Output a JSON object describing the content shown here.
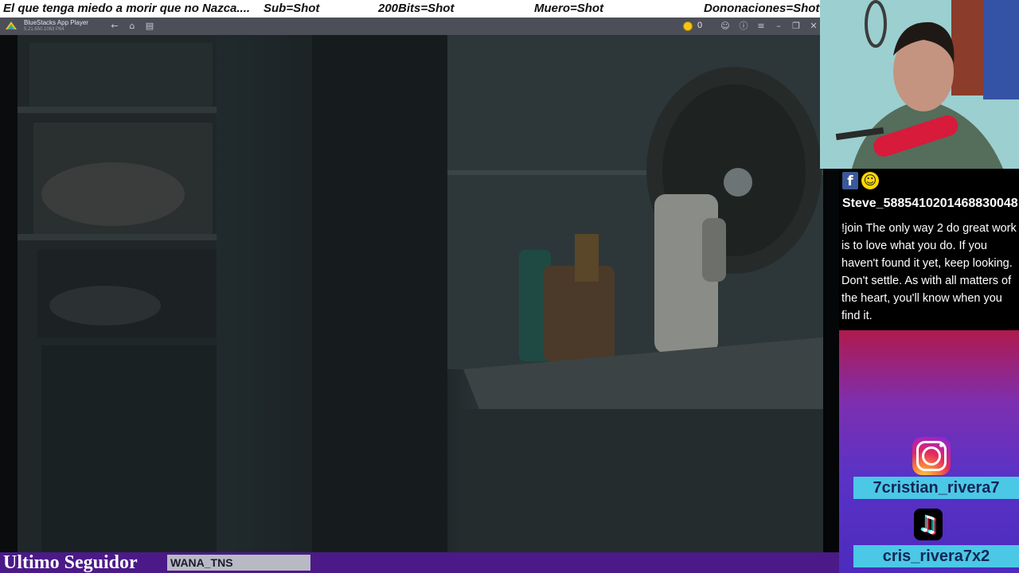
{
  "ticker": {
    "items": [
      "El que tenga miedo a morir que no Nazca....",
      "Sub=Shot",
      "200Bits=Shot",
      "Muero=Shot",
      "Dononaciones=Shot"
    ]
  },
  "app_window": {
    "title": "BlueStacks App Player",
    "version": "5.21.650.1063 P64",
    "coin_count": "0",
    "icons": [
      "back-icon",
      "home-icon",
      "multi-instance-icon",
      "coin-icon",
      "account-icon",
      "help-icon",
      "menu-icon",
      "minimize-icon",
      "restore-icon",
      "close-icon"
    ]
  },
  "chat": {
    "badge_icons": [
      "facebook-icon",
      "smiley-icon"
    ],
    "username": "Steve_5885410201468830048",
    "message": "!join The only way 2 do great work is to love what you do. If you haven't found it yet, keep looking. Don't settle. As with all matters of the heart, you'll know when you find it."
  },
  "social": {
    "instagram_handle": "7cristian_rivera7",
    "tiktok_handle": "cris_rivera7x2",
    "handle_box_color": "#4bc8e6"
  },
  "footer": {
    "label": "Ultimo Seguidor",
    "last_follower": "WANA_TNS"
  },
  "colors": {
    "bottom_bar": "#4b1a88",
    "bluestacks_bar": "#4d4f58"
  }
}
